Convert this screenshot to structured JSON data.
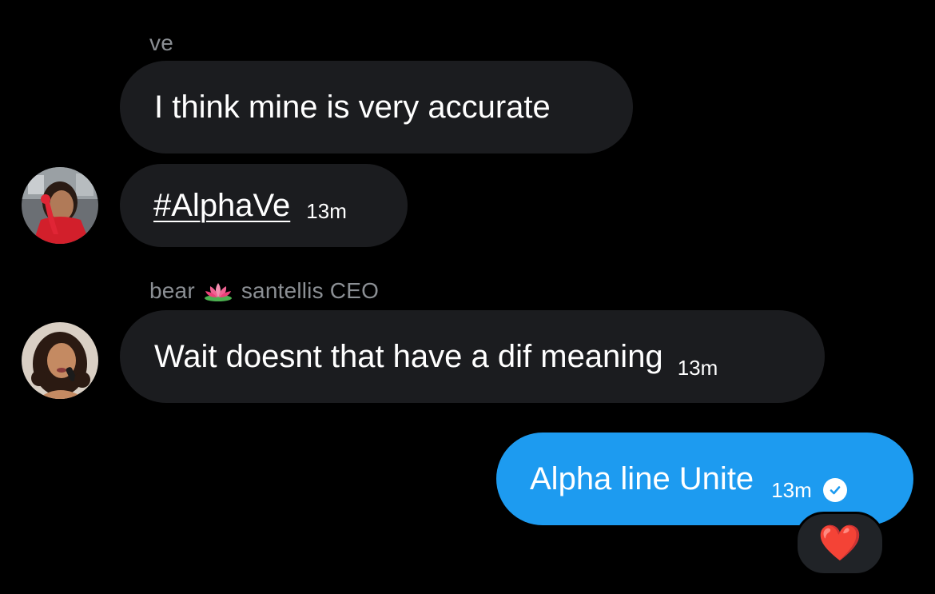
{
  "messages": [
    {
      "sender": "ve",
      "lines": [
        {
          "text": "I think mine is very accurate"
        },
        {
          "hashtag": "#AlphaVe",
          "time": "13m"
        }
      ]
    },
    {
      "sender": "bear",
      "sender_suffix": "santellis CEO",
      "sender_emoji_icon": "lotus-icon",
      "lines": [
        {
          "text": "Wait doesnt that have a dif meaning",
          "time": "13m"
        }
      ]
    }
  ],
  "sent": {
    "text": "Alpha line Unite",
    "time": "13m",
    "status_icon": "seen-check-icon",
    "reaction": "❤️"
  },
  "colors": {
    "background": "#000000",
    "received_bubble": "#1b1c1f",
    "sent_bubble": "#1d9bf0",
    "sender_name": "#8b8f94",
    "reaction_pill": "#202327"
  }
}
